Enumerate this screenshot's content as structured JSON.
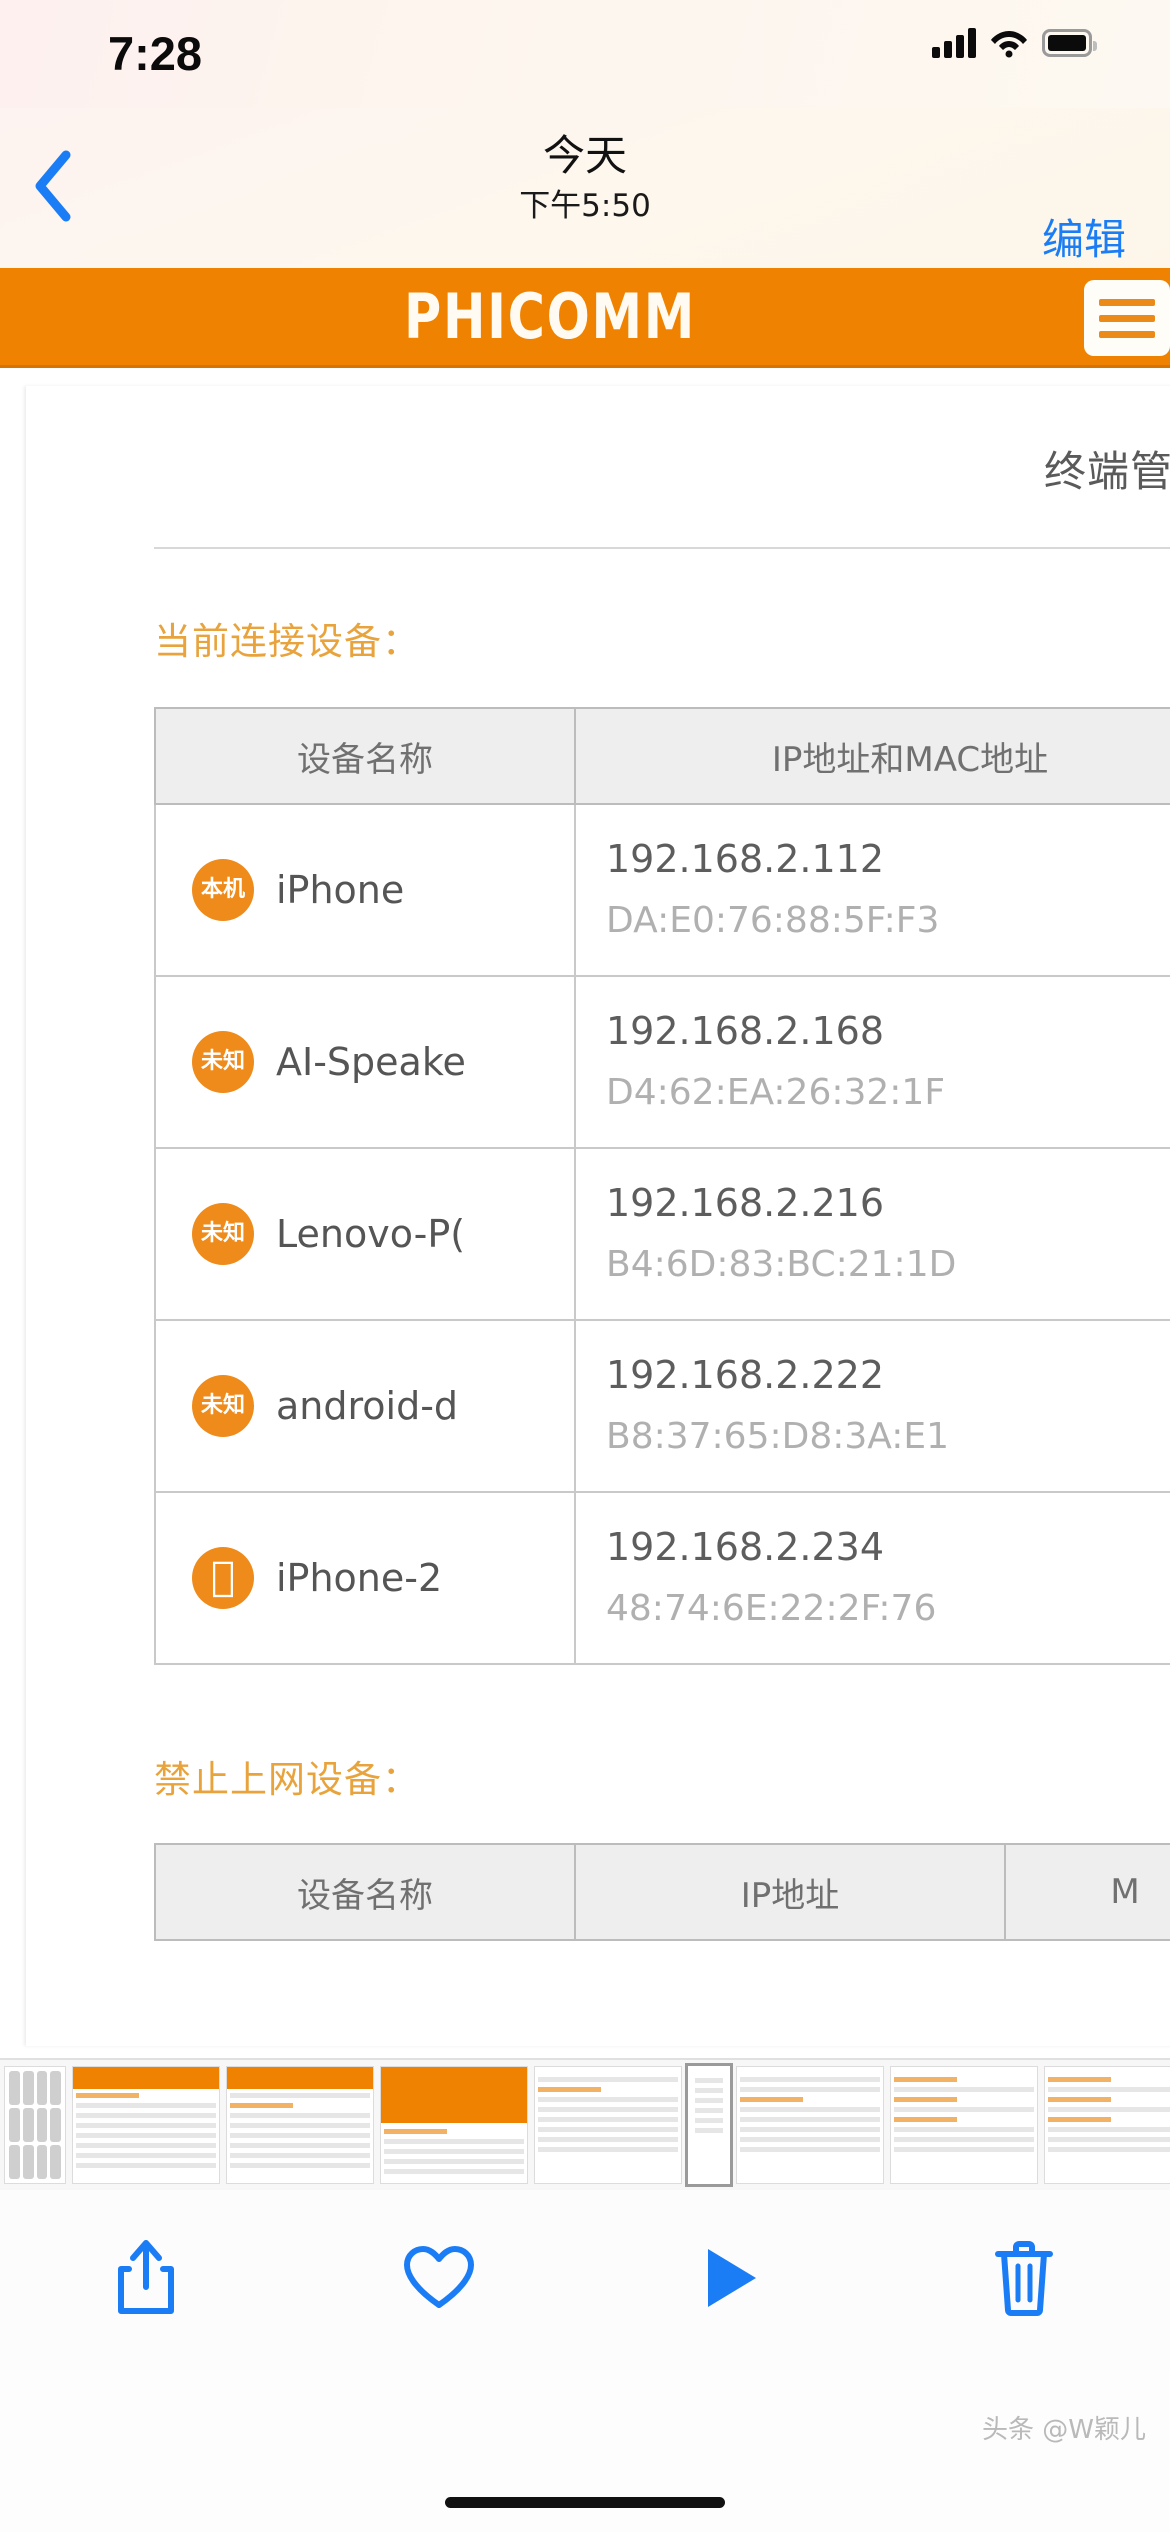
{
  "status_bar": {
    "time": "7:28",
    "icons": [
      "cellular-signal-icon",
      "wifi-icon",
      "battery-icon"
    ]
  },
  "nav_bar": {
    "back_icon": "chevron-left-icon",
    "title": "今天",
    "subtitle": "下午5:50",
    "edit_label": "编辑"
  },
  "router_page": {
    "brand": "PHICOMM",
    "menu_icon": "hamburger-menu-icon",
    "page_title": "终端管理",
    "connected": {
      "heading": "当前连接设备：",
      "columns": [
        "设备名称",
        "IP地址和MAC地址"
      ],
      "rows": [
        {
          "badge": "本机",
          "badge_type": "text",
          "name": "iPhone",
          "ip": "192.168.2.112",
          "mac": "DA:E0:76:88:5F:F3"
        },
        {
          "badge": "未知",
          "badge_type": "text",
          "name": "AI-Speake",
          "ip": "192.168.2.168",
          "mac": "D4:62:EA:26:32:1F"
        },
        {
          "badge": "未知",
          "badge_type": "text",
          "name": "Lenovo-P(",
          "ip": "192.168.2.216",
          "mac": "B4:6D:83:BC:21:1D"
        },
        {
          "badge": "未知",
          "badge_type": "text",
          "name": "android-d",
          "ip": "192.168.2.222",
          "mac": "B8:37:65:D8:3A:E1"
        },
        {
          "badge": "",
          "badge_type": "apple-logo-icon",
          "name": "iPhone-2",
          "ip": "192.168.2.234",
          "mac": "48:74:6E:22:2F:76"
        }
      ]
    },
    "blocked": {
      "heading": "禁止上网设备：",
      "columns": [
        "设备名称",
        "IP地址",
        "M"
      ]
    },
    "colors": {
      "brand_orange": "#ef8200",
      "heading_orange": "#e8a33c",
      "badge_orange": "#ee8b1b"
    }
  },
  "toolbar": {
    "items": [
      {
        "icon": "share-icon",
        "label": ""
      },
      {
        "icon": "heart-icon",
        "label": ""
      },
      {
        "icon": "play-icon",
        "label": ""
      },
      {
        "icon": "trash-icon",
        "label": ""
      }
    ],
    "accent_color": "#1b7df5"
  },
  "watermark": "头条 @W颖儿"
}
